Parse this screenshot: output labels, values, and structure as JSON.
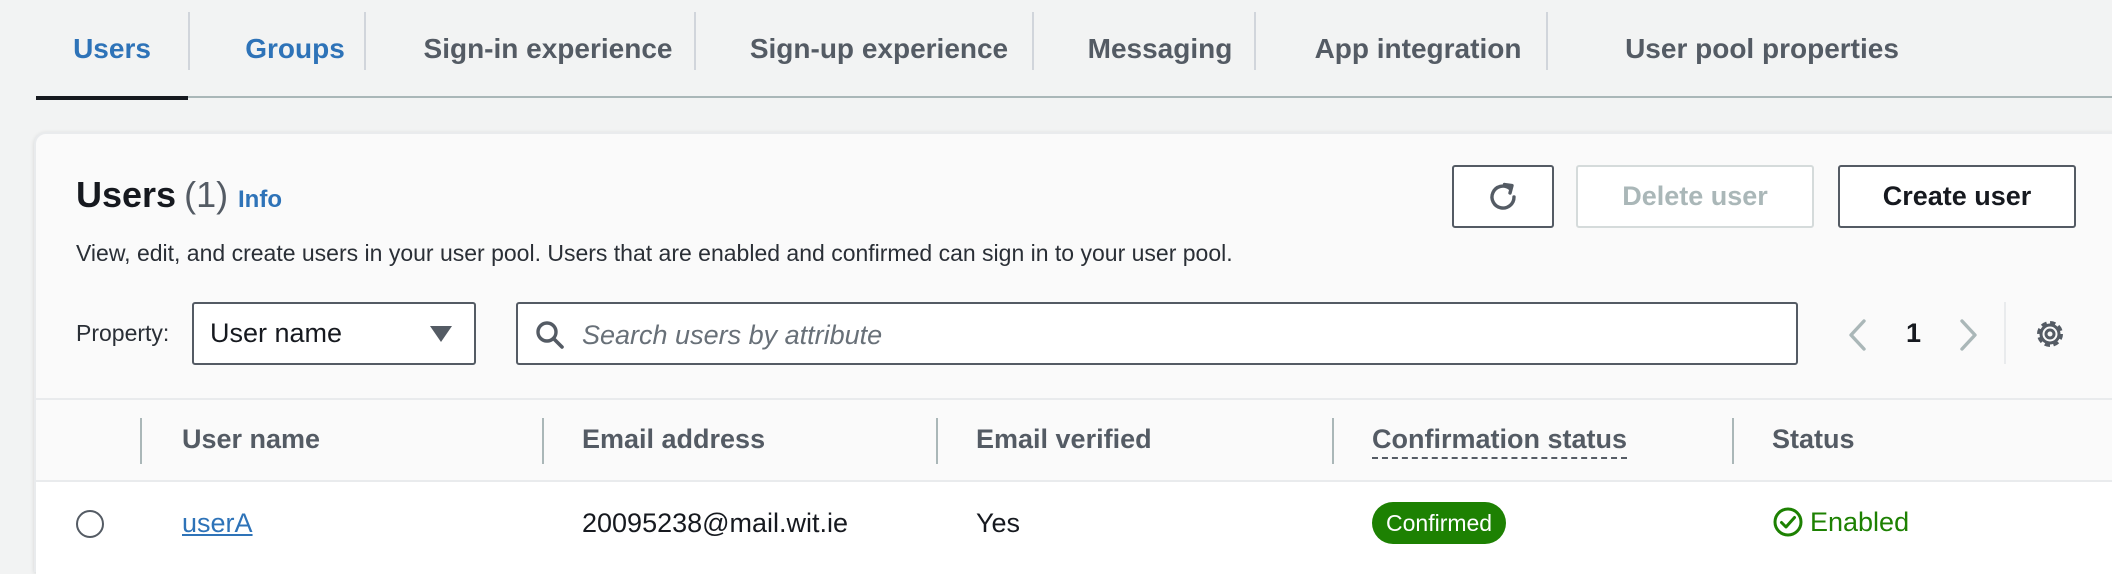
{
  "tabs": [
    {
      "label": "Users"
    },
    {
      "label": "Groups"
    },
    {
      "label": "Sign-in experience"
    },
    {
      "label": "Sign-up experience"
    },
    {
      "label": "Messaging"
    },
    {
      "label": "App integration"
    },
    {
      "label": "User pool properties"
    }
  ],
  "panel": {
    "title": "Users",
    "count": "(1)",
    "info": "Info",
    "description": "View, edit, and create users in your user pool. Users that are enabled and confirmed can sign in to your user pool.",
    "refresh_icon": "refresh-icon",
    "delete_label": "Delete user",
    "create_label": "Create user"
  },
  "filter": {
    "property_label": "Property:",
    "property_value": "User name",
    "search_placeholder": "Search users by attribute",
    "search_icon": "search-icon"
  },
  "pagination": {
    "current_page": "1",
    "prev_icon": "chevron-left-icon",
    "next_icon": "chevron-right-icon",
    "settings_icon": "gear-icon"
  },
  "table": {
    "columns": [
      "User name",
      "Email address",
      "Email verified",
      "Confirmation status",
      "Status"
    ],
    "rows": [
      {
        "user_name": "userA",
        "email": "20095238@mail.wit.ie",
        "email_verified": "Yes",
        "confirmation_status": "Confirmed",
        "status": "Enabled"
      }
    ]
  },
  "colors": {
    "link": "#2e73b8",
    "success": "#1d8102",
    "text": "#16191f",
    "muted": "#545b64"
  }
}
